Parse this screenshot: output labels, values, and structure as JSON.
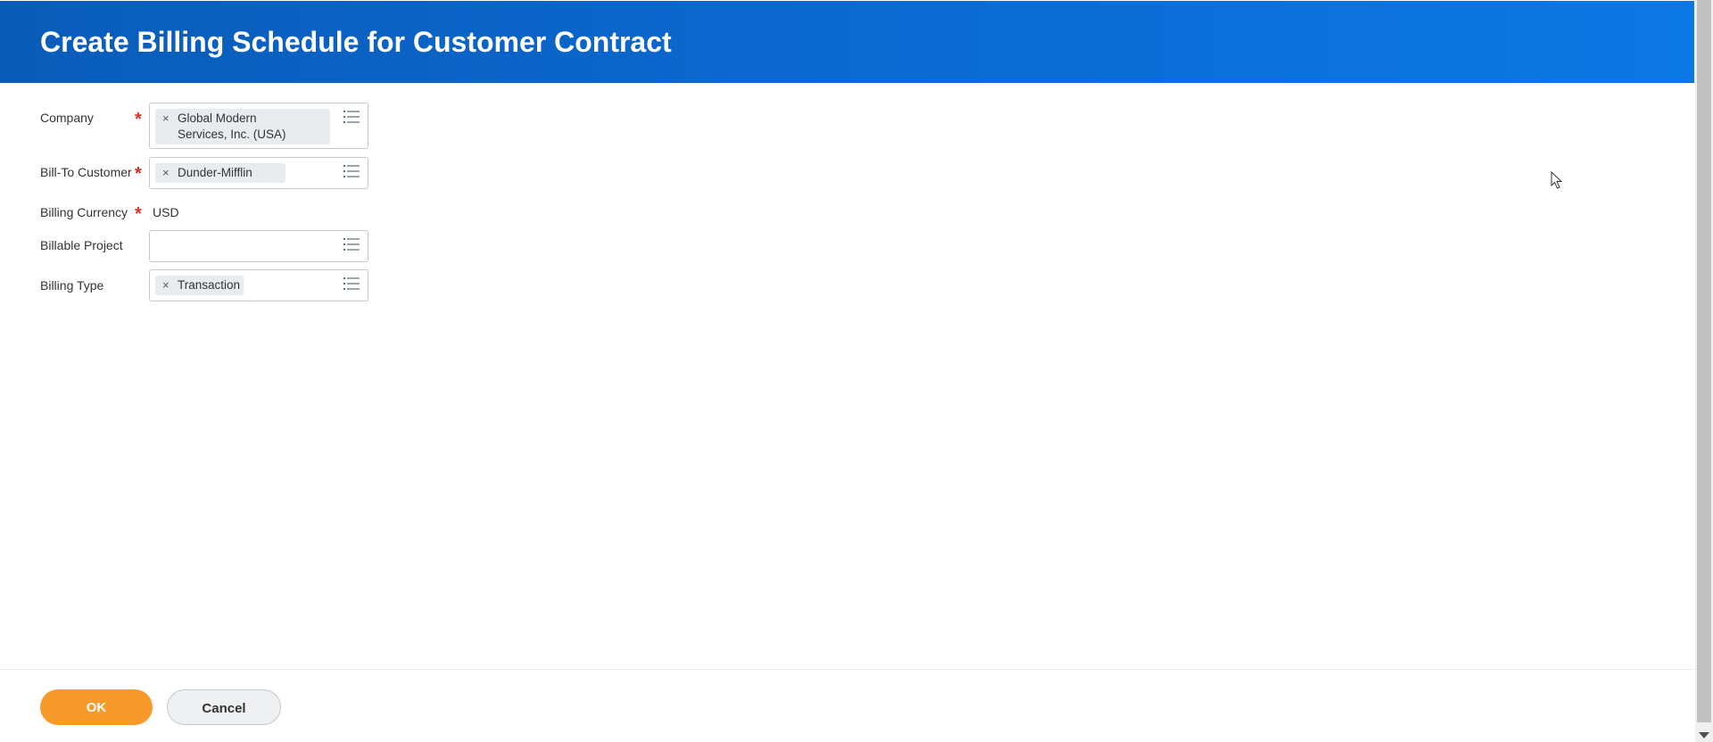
{
  "header": {
    "title": "Create Billing Schedule for Customer Contract"
  },
  "form": {
    "company": {
      "label": "Company",
      "required_mark": "*",
      "value_line1": "Global Modern",
      "value_line2": "Services, Inc. (USA)",
      "remove_glyph": "×"
    },
    "bill_to_customer": {
      "label": "Bill-To Customer",
      "required_mark": "*",
      "value": "Dunder-Mifflin",
      "remove_glyph": "×"
    },
    "billing_currency": {
      "label": "Billing Currency",
      "required_mark": "*",
      "value": "USD"
    },
    "billable_project": {
      "label": "Billable Project",
      "value": ""
    },
    "billing_type": {
      "label": "Billing Type",
      "value": "Transaction",
      "remove_glyph": "×"
    }
  },
  "footer": {
    "ok_label": "OK",
    "cancel_label": "Cancel"
  },
  "icons": {
    "prompt": "list-icon",
    "remove": "close-icon"
  },
  "colors": {
    "header_blue": "#0a6cd6",
    "required_red": "#de2e21",
    "ok_orange": "#f89a2a"
  }
}
